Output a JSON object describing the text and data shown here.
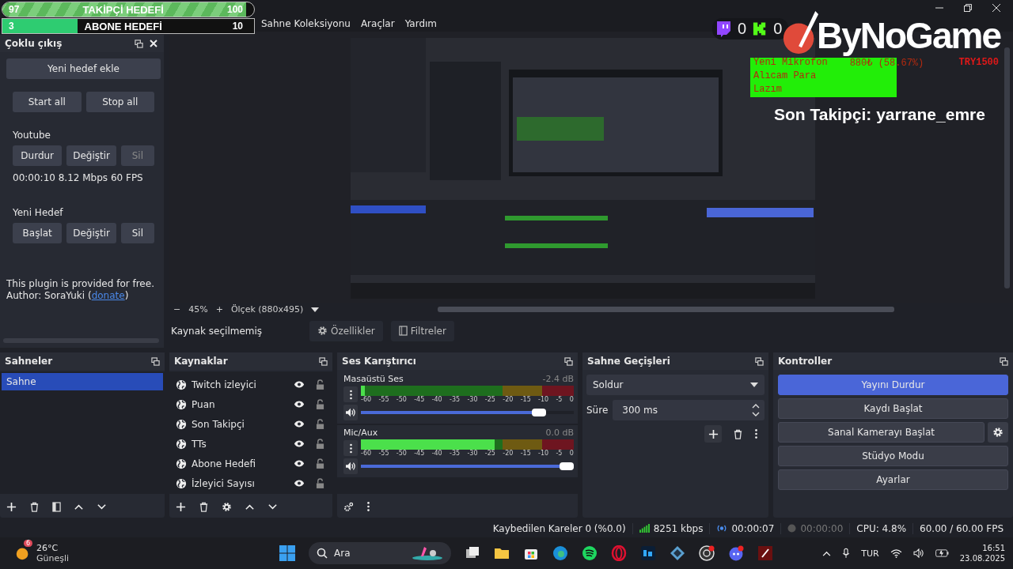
{
  "window": {
    "menu": [
      "Sahne Koleksiyonu",
      "Araçlar",
      "Yardım"
    ]
  },
  "overlays": {
    "goals": [
      {
        "current": "97",
        "label": "TAKİPÇİ HEDEFİ",
        "target": "100",
        "level": 0.97,
        "kind": "striped"
      },
      {
        "current": "3",
        "label": "ABONE HEDEFİ",
        "target": "10",
        "level": 0.3,
        "kind": "solid"
      }
    ],
    "twitch_count": "0",
    "kick_count": "0",
    "logo": "ByNoGame",
    "donation": {
      "item": "Yeni Mikrofon",
      "amount": "880₺ (58.67%)",
      "goal": "TRY1500",
      "message": "Alıcam Para Lazım"
    },
    "last_follower": "Son Takipçi: yarrane_emre"
  },
  "multi_output": {
    "title": "Çoklu çıkış",
    "add_button": "Yeni hedef ekle",
    "start_all": "Start all",
    "stop_all": "Stop all",
    "targets": [
      {
        "name": "Youtube",
        "buttons": [
          {
            "label": "Durdur",
            "disabled": false
          },
          {
            "label": "Değiştir",
            "disabled": false
          },
          {
            "label": "Sil",
            "disabled": true
          }
        ],
        "stats": "00:00:10  8.12 Mbps  60 FPS"
      },
      {
        "name": "Yeni Hedef",
        "buttons": [
          {
            "label": "Başlat",
            "disabled": false
          },
          {
            "label": "Değiştir",
            "disabled": false
          },
          {
            "label": "Sil",
            "disabled": false
          }
        ]
      }
    ],
    "note": "This plugin is provided for free.",
    "author": "Author: SoraYuki (",
    "donate_link": "donate",
    "author_end": ")"
  },
  "preview": {
    "zoom": "45%",
    "zoom_out": "−",
    "zoom_in": "+",
    "scale": "Ölçek (880x495)"
  },
  "source_toolbar": {
    "status": "Kaynak seçilmemiş",
    "properties": "Özellikler",
    "filters": "Filtreler"
  },
  "scenes": {
    "title": "Sahneler",
    "items": [
      {
        "name": "Sahne",
        "selected": true
      }
    ]
  },
  "sources": {
    "title": "Kaynaklar",
    "items": [
      {
        "name": "Twitch izleyici",
        "visible": true,
        "locked": false
      },
      {
        "name": "Puan",
        "visible": true,
        "locked": false
      },
      {
        "name": "Son Takipçi",
        "visible": true,
        "locked": false
      },
      {
        "name": "TTs",
        "visible": true,
        "locked": false
      },
      {
        "name": "Abone Hedefi",
        "visible": true,
        "locked": false
      },
      {
        "name": "İzleyici Sayısı",
        "visible": true,
        "locked": false
      }
    ]
  },
  "mixer": {
    "title": "Ses Karıştırıcı",
    "channels": [
      {
        "name": "Masaüstü Ses",
        "reading": "-2.4 dB",
        "meter": {
          "level": 0.02
        },
        "volume": {
          "level": 0.86
        },
        "muted": false,
        "scale": [
          "-60",
          "-55",
          "-50",
          "-45",
          "-40",
          "-35",
          "-30",
          "-25",
          "-20",
          "-15",
          "-10",
          "-5",
          "0"
        ]
      },
      {
        "name": "Mic/Aux",
        "reading": "0.0 dB",
        "meter": {
          "level": 0.63
        },
        "volume": {
          "level": 1.0
        },
        "muted": false,
        "scale": [
          "-60",
          "-55",
          "-50",
          "-45",
          "-40",
          "-35",
          "-30",
          "-25",
          "-20",
          "-15",
          "-10",
          "-5",
          "0"
        ]
      }
    ]
  },
  "transitions": {
    "title": "Sahne Geçişleri",
    "transition": "Soldur",
    "duration_label": "Süre",
    "duration": "300 ms"
  },
  "controls": {
    "title": "Kontroller",
    "buttons": [
      {
        "label": "Yayını Durdur",
        "active": true,
        "kind": "plain"
      },
      {
        "label": "Kaydı Başlat",
        "active": false,
        "kind": "plain"
      },
      {
        "label": "Sanal Kamerayı Başlat",
        "active": false,
        "kind": "gear"
      },
      {
        "label": "Stüdyo Modu",
        "active": false,
        "kind": "plain"
      },
      {
        "label": "Ayarlar",
        "active": false,
        "kind": "plain"
      }
    ]
  },
  "status_bar": {
    "dropped": "Kaybedilen Kareler 0 (%0.0)",
    "bitrate": "8251 kbps",
    "stream_time": "00:00:07",
    "record_time": "00:00:00",
    "cpu": "CPU: 4.8%",
    "fps": "60.00 / 60.00 FPS"
  },
  "taskbar": {
    "weather": {
      "temp": "26°C",
      "condition": "Güneşli",
      "badge": "6"
    },
    "search": "Ara",
    "language": "TUR",
    "time": "16:51",
    "date": "23.08.2025"
  }
}
